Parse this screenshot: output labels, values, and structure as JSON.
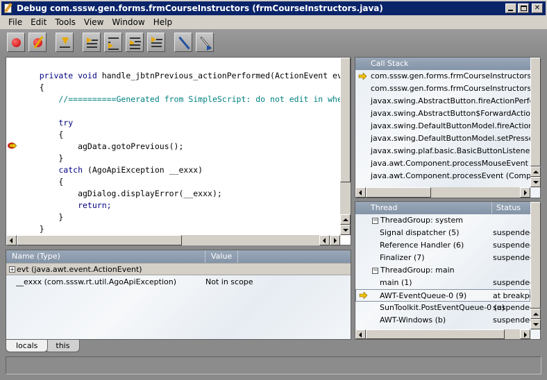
{
  "window": {
    "title": "Debug com.sssw.gen.forms.frmCourseInstructors (frmCourseInstructors.java)"
  },
  "menu": [
    "File",
    "Edit",
    "Tools",
    "View",
    "Window",
    "Help"
  ],
  "toolbar": [
    "record-icon",
    "clear-icon",
    "step-into-icon",
    "step-over-icon",
    "step-out-icon",
    "run-to-cursor-icon",
    "run-icon",
    "inspect-icon",
    "evaluate-icon"
  ],
  "editor": {
    "lines": [
      {
        "text": "    private void handle_jbtnPrevious_actionPerformed(ActionEvent ev",
        "type": "code"
      },
      {
        "text": "    {",
        "type": "code"
      },
      {
        "text": "        //==========Generated from SimpleScript: do not edit in whe",
        "type": "comment"
      },
      {
        "text": "",
        "type": "code"
      },
      {
        "text": "        try",
        "type": "kw"
      },
      {
        "text": "        {",
        "type": "code"
      },
      {
        "text": "            agData.gotoPrevious();",
        "type": "code",
        "breakpoint": true
      },
      {
        "text": "        }",
        "type": "code"
      },
      {
        "text": "        catch (AgoApiException __exxx)",
        "type": "code"
      },
      {
        "text": "        {",
        "type": "code"
      },
      {
        "text": "            agDialog.displayError(__exxx);",
        "type": "code"
      },
      {
        "text": "            return;",
        "type": "code"
      },
      {
        "text": "        }",
        "type": "code"
      },
      {
        "text": "    }",
        "type": "code"
      }
    ]
  },
  "variables": {
    "headers": {
      "name": "Name (Type)",
      "value": "Value"
    },
    "rows": [
      {
        "name": "evt (java.awt.event.ActionEvent)",
        "value": "",
        "expandable": true
      },
      {
        "name": "__exxx (com.sssw.rt.util.AgoApiException)",
        "value": "Not in scope",
        "expandable": false
      }
    ],
    "tabs": [
      "locals",
      "this"
    ]
  },
  "callstack": {
    "header": "Call Stack",
    "rows": [
      "com.sssw.gen.forms.frmCourseInstructors.han",
      "com.sssw.gen.forms.frmCourseInstructors.act",
      "javax.swing.AbstractButton.fireActionPerforme",
      "javax.swing.AbstractButton$ForwardActionEve",
      "javax.swing.DefaultButtonModel.fireActionPerfo",
      "javax.swing.DefaultButtonModel.setPressed (D",
      "javax.swing.plaf.basic.BasicButtonListener.mou",
      "java.awt.Component.processMouseEvent (Com",
      "java.awt.Component.processEvent (Componen"
    ]
  },
  "threads": {
    "headers": {
      "thread": "Thread",
      "status": "Status"
    },
    "rows": [
      {
        "name": "ThreadGroup: system",
        "status": "",
        "group": true
      },
      {
        "name": "Signal dispatcher (5)",
        "status": "suspended"
      },
      {
        "name": "Reference Handler (6)",
        "status": "suspended"
      },
      {
        "name": "Finalizer (7)",
        "status": "suspended"
      },
      {
        "name": "ThreadGroup: main",
        "status": "",
        "group": true
      },
      {
        "name": "main (1)",
        "status": "suspended"
      },
      {
        "name": "AWT-EventQueue-0 (9)",
        "status": "at breakpoi",
        "current": true
      },
      {
        "name": "SunToolkit.PostEventQueue-0 (a)",
        "status": "suspended"
      },
      {
        "name": "AWT-Windows (b)",
        "status": "suspended"
      }
    ]
  }
}
